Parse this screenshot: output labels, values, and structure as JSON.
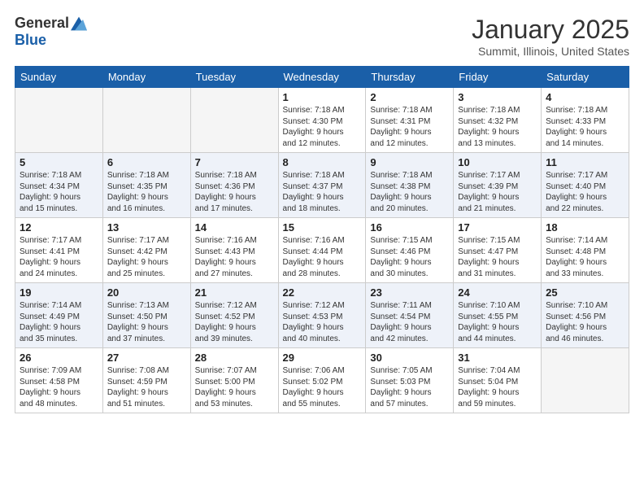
{
  "header": {
    "logo_general": "General",
    "logo_blue": "Blue",
    "title": "January 2025",
    "subtitle": "Summit, Illinois, United States"
  },
  "days_of_week": [
    "Sunday",
    "Monday",
    "Tuesday",
    "Wednesday",
    "Thursday",
    "Friday",
    "Saturday"
  ],
  "weeks": [
    [
      {
        "day": "",
        "info": ""
      },
      {
        "day": "",
        "info": ""
      },
      {
        "day": "",
        "info": ""
      },
      {
        "day": "1",
        "info": "Sunrise: 7:18 AM\nSunset: 4:30 PM\nDaylight: 9 hours\nand 12 minutes."
      },
      {
        "day": "2",
        "info": "Sunrise: 7:18 AM\nSunset: 4:31 PM\nDaylight: 9 hours\nand 12 minutes."
      },
      {
        "day": "3",
        "info": "Sunrise: 7:18 AM\nSunset: 4:32 PM\nDaylight: 9 hours\nand 13 minutes."
      },
      {
        "day": "4",
        "info": "Sunrise: 7:18 AM\nSunset: 4:33 PM\nDaylight: 9 hours\nand 14 minutes."
      }
    ],
    [
      {
        "day": "5",
        "info": "Sunrise: 7:18 AM\nSunset: 4:34 PM\nDaylight: 9 hours\nand 15 minutes."
      },
      {
        "day": "6",
        "info": "Sunrise: 7:18 AM\nSunset: 4:35 PM\nDaylight: 9 hours\nand 16 minutes."
      },
      {
        "day": "7",
        "info": "Sunrise: 7:18 AM\nSunset: 4:36 PM\nDaylight: 9 hours\nand 17 minutes."
      },
      {
        "day": "8",
        "info": "Sunrise: 7:18 AM\nSunset: 4:37 PM\nDaylight: 9 hours\nand 18 minutes."
      },
      {
        "day": "9",
        "info": "Sunrise: 7:18 AM\nSunset: 4:38 PM\nDaylight: 9 hours\nand 20 minutes."
      },
      {
        "day": "10",
        "info": "Sunrise: 7:17 AM\nSunset: 4:39 PM\nDaylight: 9 hours\nand 21 minutes."
      },
      {
        "day": "11",
        "info": "Sunrise: 7:17 AM\nSunset: 4:40 PM\nDaylight: 9 hours\nand 22 minutes."
      }
    ],
    [
      {
        "day": "12",
        "info": "Sunrise: 7:17 AM\nSunset: 4:41 PM\nDaylight: 9 hours\nand 24 minutes."
      },
      {
        "day": "13",
        "info": "Sunrise: 7:17 AM\nSunset: 4:42 PM\nDaylight: 9 hours\nand 25 minutes."
      },
      {
        "day": "14",
        "info": "Sunrise: 7:16 AM\nSunset: 4:43 PM\nDaylight: 9 hours\nand 27 minutes."
      },
      {
        "day": "15",
        "info": "Sunrise: 7:16 AM\nSunset: 4:44 PM\nDaylight: 9 hours\nand 28 minutes."
      },
      {
        "day": "16",
        "info": "Sunrise: 7:15 AM\nSunset: 4:46 PM\nDaylight: 9 hours\nand 30 minutes."
      },
      {
        "day": "17",
        "info": "Sunrise: 7:15 AM\nSunset: 4:47 PM\nDaylight: 9 hours\nand 31 minutes."
      },
      {
        "day": "18",
        "info": "Sunrise: 7:14 AM\nSunset: 4:48 PM\nDaylight: 9 hours\nand 33 minutes."
      }
    ],
    [
      {
        "day": "19",
        "info": "Sunrise: 7:14 AM\nSunset: 4:49 PM\nDaylight: 9 hours\nand 35 minutes."
      },
      {
        "day": "20",
        "info": "Sunrise: 7:13 AM\nSunset: 4:50 PM\nDaylight: 9 hours\nand 37 minutes."
      },
      {
        "day": "21",
        "info": "Sunrise: 7:12 AM\nSunset: 4:52 PM\nDaylight: 9 hours\nand 39 minutes."
      },
      {
        "day": "22",
        "info": "Sunrise: 7:12 AM\nSunset: 4:53 PM\nDaylight: 9 hours\nand 40 minutes."
      },
      {
        "day": "23",
        "info": "Sunrise: 7:11 AM\nSunset: 4:54 PM\nDaylight: 9 hours\nand 42 minutes."
      },
      {
        "day": "24",
        "info": "Sunrise: 7:10 AM\nSunset: 4:55 PM\nDaylight: 9 hours\nand 44 minutes."
      },
      {
        "day": "25",
        "info": "Sunrise: 7:10 AM\nSunset: 4:56 PM\nDaylight: 9 hours\nand 46 minutes."
      }
    ],
    [
      {
        "day": "26",
        "info": "Sunrise: 7:09 AM\nSunset: 4:58 PM\nDaylight: 9 hours\nand 48 minutes."
      },
      {
        "day": "27",
        "info": "Sunrise: 7:08 AM\nSunset: 4:59 PM\nDaylight: 9 hours\nand 51 minutes."
      },
      {
        "day": "28",
        "info": "Sunrise: 7:07 AM\nSunset: 5:00 PM\nDaylight: 9 hours\nand 53 minutes."
      },
      {
        "day": "29",
        "info": "Sunrise: 7:06 AM\nSunset: 5:02 PM\nDaylight: 9 hours\nand 55 minutes."
      },
      {
        "day": "30",
        "info": "Sunrise: 7:05 AM\nSunset: 5:03 PM\nDaylight: 9 hours\nand 57 minutes."
      },
      {
        "day": "31",
        "info": "Sunrise: 7:04 AM\nSunset: 5:04 PM\nDaylight: 9 hours\nand 59 minutes."
      },
      {
        "day": "",
        "info": ""
      }
    ]
  ]
}
